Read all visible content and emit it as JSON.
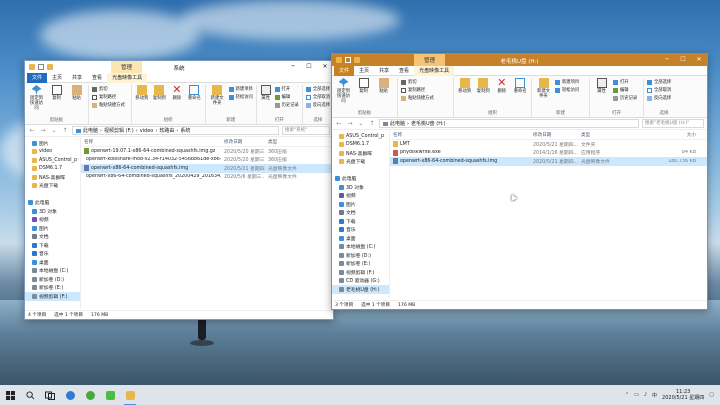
{
  "left_window": {
    "context_tab": "管理",
    "app_tab": "系统",
    "ribbon_tabs": [
      "文件",
      "主页",
      "共享",
      "查看",
      "光盘映像工具"
    ],
    "groups": {
      "clipboard": {
        "name": "剪贴板",
        "pin_label": "固定到快速访问",
        "copy_label": "复制",
        "paste_label": "粘贴",
        "cut_label": "剪切",
        "copy_path_label": "复制路径",
        "paste_shortcut_label": "粘贴快捷方式"
      },
      "organize": {
        "name": "组织",
        "move_label": "移动到",
        "copyto_label": "复制到",
        "delete_label": "删除",
        "rename_label": "重命名"
      },
      "new": {
        "name": "新建",
        "folder_label": "新建文件夹",
        "new_item_label": "新建项目",
        "easy_access_label": "轻松访问"
      },
      "open": {
        "name": "打开",
        "props_label": "属性",
        "open_label": "打开",
        "edit_label": "编辑",
        "history_label": "历史记录"
      },
      "select": {
        "name": "选择",
        "all_label": "全部选择",
        "none_label": "全部取消",
        "invert_label": "反向选择"
      }
    },
    "breadcrumb": [
      "此电脑",
      "视频剪辑 (F:)",
      "video",
      "软路由",
      "系统"
    ],
    "search_placeholder": "搜索\"系统\"",
    "nav": [
      {
        "label": "图片",
        "ind": true,
        "color": "#3c8fd9"
      },
      {
        "label": "video",
        "ind": true,
        "color": "#e8b64a"
      },
      {
        "label": "ASUS_Control_p",
        "ind": true,
        "color": "#e8b64a"
      },
      {
        "label": "DSM6.1.7",
        "ind": true,
        "color": "#e8b64a"
      },
      {
        "label": "NAS-黑群晖",
        "ind": true,
        "color": "#e8b64a"
      },
      {
        "label": "光盘下载",
        "ind": true,
        "color": "#e8b64a"
      },
      {
        "label": "",
        "ind": false,
        "color": ""
      },
      {
        "label": "此电脑",
        "ind": false,
        "color": "#3c8fd9"
      },
      {
        "label": "3D 对象",
        "ind": true,
        "color": "#3c8fd9"
      },
      {
        "label": "视频",
        "ind": true,
        "color": "#6d4fb8"
      },
      {
        "label": "图片",
        "ind": true,
        "color": "#3c8fd9"
      },
      {
        "label": "文档",
        "ind": true,
        "color": "#6b7d8f"
      },
      {
        "label": "下载",
        "ind": true,
        "color": "#2a78d1"
      },
      {
        "label": "音乐",
        "ind": true,
        "color": "#2a78d1"
      },
      {
        "label": "桌面",
        "ind": true,
        "color": "#3c8fd9"
      },
      {
        "label": "本地磁盘 (C:)",
        "ind": true,
        "color": "#7a8a99"
      },
      {
        "label": "新加卷 (D:)",
        "ind": true,
        "color": "#7a8a99"
      },
      {
        "label": "新加卷 (E:)",
        "ind": true,
        "color": "#7a8a99"
      },
      {
        "label": "视频剪辑 (F:)",
        "ind": true,
        "color": "#7a8a99",
        "sel": true
      }
    ],
    "columns": {
      "name": "名称",
      "date": "修改日期",
      "type": "类型"
    },
    "files": [
      {
        "name": "openwrt-19.07.1-x86-64-combined-squashfs.img.gz",
        "date": "2020/5/20 星期三...",
        "type": "360压缩",
        "color": "#6a9a3a",
        "sel": false
      },
      {
        "name": "openwrt-koolshare-mod-v2.34-r14032-5456b861de-x86-64-c...",
        "date": "2020/5/20 星期三...",
        "type": "360压缩",
        "color": "#6a9a3a",
        "sel": false
      },
      {
        "name": "openwrt-x86-64-combined-squashfs.img",
        "date": "2020/5/21 星期四...",
        "type": "光盘映像文件",
        "color": "#5c7ea6",
        "sel": true
      },
      {
        "name": "openwrt-x86-64-combined-squashfs_20200429_201634.img",
        "date": "2020/5/6 星期三...",
        "type": "光盘映像文件",
        "color": "#5c7ea6",
        "sel": false
      }
    ],
    "status": {
      "count": "4 个项目",
      "selected": "选中 1 个项目",
      "size": "176 MB"
    }
  },
  "right_window": {
    "context_tab": "管理",
    "title": "老毛桃U盘 (H:)",
    "ribbon_tabs": [
      "文件",
      "主页",
      "共享",
      "查看",
      "光盘映像工具"
    ],
    "breadcrumb": [
      "此电脑",
      "老毛桃U盘 (H:)"
    ],
    "search_placeholder": "搜索\"老毛桃U盘 (H:)\"",
    "nav": [
      {
        "label": "ASUS_Control_p",
        "ind": true,
        "color": "#e8b64a"
      },
      {
        "label": "DSM6.1.7",
        "ind": true,
        "color": "#e8b64a"
      },
      {
        "label": "NAS-黑群晖",
        "ind": true,
        "color": "#e8b64a"
      },
      {
        "label": "光盘下载",
        "ind": true,
        "color": "#e8b64a"
      },
      {
        "label": "",
        "ind": false,
        "color": ""
      },
      {
        "label": "此电脑",
        "ind": false,
        "color": "#3c8fd9"
      },
      {
        "label": "3D 对象",
        "ind": true,
        "color": "#3c8fd9"
      },
      {
        "label": "视频",
        "ind": true,
        "color": "#6d4fb8"
      },
      {
        "label": "图片",
        "ind": true,
        "color": "#3c8fd9"
      },
      {
        "label": "文档",
        "ind": true,
        "color": "#6b7d8f"
      },
      {
        "label": "下载",
        "ind": true,
        "color": "#2a78d1"
      },
      {
        "label": "音乐",
        "ind": true,
        "color": "#2a78d1"
      },
      {
        "label": "桌面",
        "ind": true,
        "color": "#3c8fd9"
      },
      {
        "label": "本地磁盘 (C:)",
        "ind": true,
        "color": "#7a8a99"
      },
      {
        "label": "新加卷 (D:)",
        "ind": true,
        "color": "#7a8a99"
      },
      {
        "label": "新加卷 (E:)",
        "ind": true,
        "color": "#7a8a99"
      },
      {
        "label": "视频剪辑 (F:)",
        "ind": true,
        "color": "#7a8a99"
      },
      {
        "label": "CD 驱动器 (G:)",
        "ind": true,
        "color": "#7a8a99"
      },
      {
        "label": "老毛桃U盘 (H:)",
        "ind": true,
        "color": "#7a8a99",
        "sel": true
      }
    ],
    "columns": {
      "name": "名称",
      "date": "修改日期",
      "type": "类型",
      "size": "大小"
    },
    "files": [
      {
        "name": "LMT",
        "date": "2020/5/21 星期四...",
        "type": "文件夹",
        "size": "",
        "color": "#e8b64a",
        "sel": false
      },
      {
        "name": "phydiskwrite.exe",
        "date": "2014/1/16 星期四...",
        "type": "应用程序",
        "size": "84 KB",
        "color": "#d9534f",
        "sel": false
      },
      {
        "name": "openwrt-x86-64-combined-squashfs.img",
        "date": "2020/5/21 星期四...",
        "type": "光盘映像文件",
        "size": "180,736 KB",
        "color": "#5c7ea6",
        "sel": true
      }
    ],
    "status": {
      "count": "3 个项目",
      "selected": "选中 1 个项目",
      "size": "176 MB"
    }
  },
  "taskbar": {
    "time": "11:23",
    "date": "2020/5/21 星期四"
  }
}
